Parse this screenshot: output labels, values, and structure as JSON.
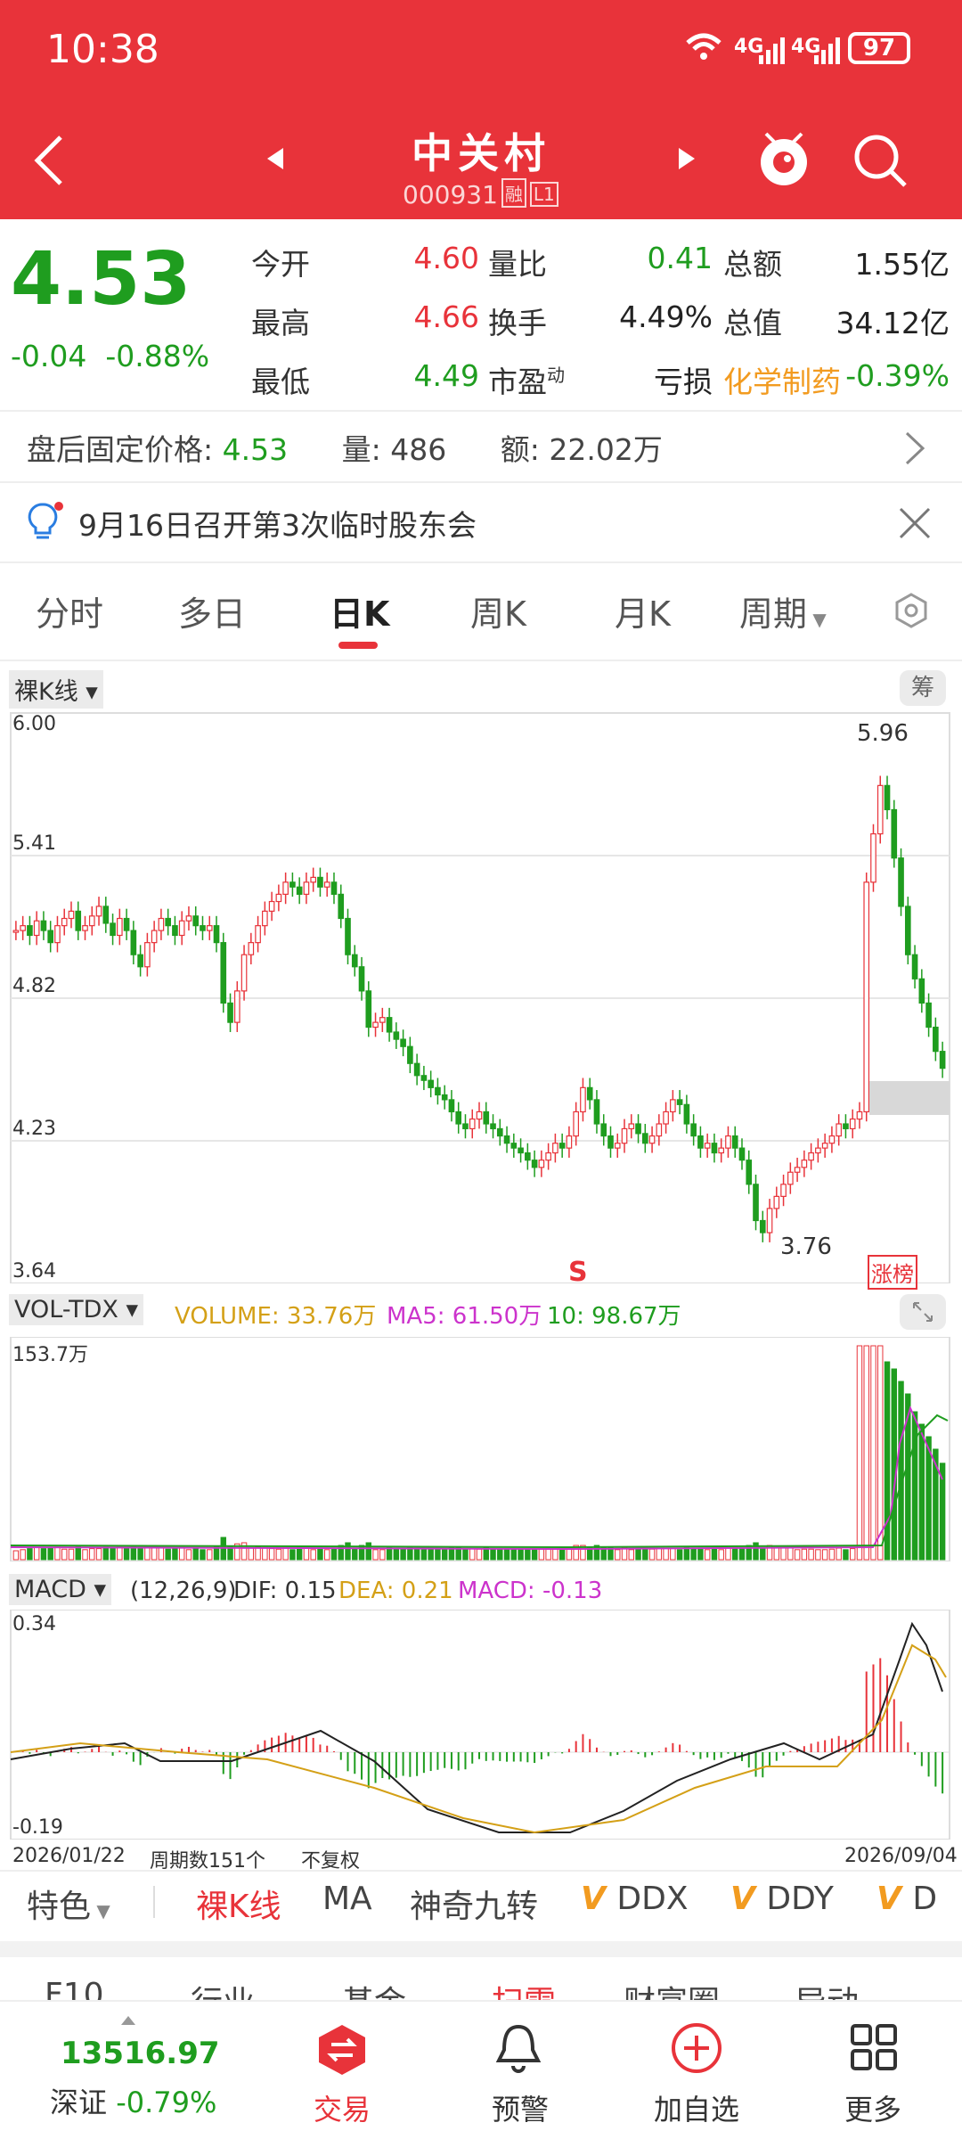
{
  "status": {
    "time": "10:38",
    "battery": "97",
    "net1": "4G",
    "net2": "4G"
  },
  "header": {
    "title": "中关村",
    "code": "000931",
    "tag1": "融",
    "tag2": "L1"
  },
  "quote": {
    "price": "4.53",
    "change": "-0.04",
    "change_pct": "-0.88%",
    "rows": [
      {
        "l1": "今开",
        "v1": "4.60",
        "l2": "量比",
        "v2": "0.41",
        "l3": "总额",
        "v3": "1.55亿"
      },
      {
        "l1": "最高",
        "v1": "4.66",
        "l2": "换手",
        "v2": "4.49%",
        "l3": "总值",
        "v3": "34.12亿"
      },
      {
        "l1": "最低",
        "v1": "4.49",
        "l2": "市盈",
        "l2sup": "动",
        "v2": "亏损",
        "l3": "化学制药",
        "v3": "-0.39%"
      }
    ]
  },
  "afterhours": {
    "price_label": "盘后固定价格:",
    "price": "4.53",
    "vol_label": "量:",
    "vol": "486",
    "amt_label": "额:",
    "amt": "22.02万"
  },
  "notice": {
    "text": "9月16日召开第3次临时股东会"
  },
  "tabs": [
    "分时",
    "多日",
    "日K",
    "周K",
    "月K",
    "周期"
  ],
  "kline": {
    "selector": "裸K线",
    "chip_button": "筹",
    "y_ticks": [
      "6.00",
      "5.41",
      "4.82",
      "4.23",
      "3.64"
    ],
    "high_label": "5.96",
    "low_label": "3.76",
    "s_marker": "S",
    "badge": "涨榜"
  },
  "volume": {
    "selector": "VOL-TDX",
    "label_volume": "VOLUME: 33.76万",
    "label_ma5": "MA5: 61.50万",
    "label_ma10": "10: 98.67万",
    "y_top": "153.7万",
    "colors": {
      "vol": "#d4a017",
      "ma5": "#cc33cc",
      "ma10": "#1f9d1f"
    }
  },
  "macd": {
    "selector": "MACD",
    "params": "(12,26,9)",
    "dif": "DIF: 0.15",
    "dea": "DEA: 0.21",
    "macd": "MACD: -0.13",
    "y_top": "0.34",
    "y_bottom": "-0.19",
    "start_date": "2026/01/22",
    "period_count": "周期数151个",
    "adjust": "不复权",
    "end_date": "2026/09/04"
  },
  "indicator_bar": [
    "特色",
    "裸K线",
    "MA",
    "神奇九转",
    "DDX",
    "DDY",
    "D"
  ],
  "lower_tabs": [
    "F10",
    "行业",
    "基金",
    "扫雷",
    "财富圈",
    "异动"
  ],
  "bottom_nav": {
    "index_value": "13516.97",
    "index_name": "深证",
    "index_change": "-0.79%",
    "items": [
      "交易",
      "预警",
      "加自选",
      "更多"
    ]
  },
  "chart_data": {
    "type": "candlestick",
    "x_range": [
      "2026/01/22",
      "2026/09/04"
    ],
    "ylim": [
      3.64,
      6.0
    ],
    "n_periods": 151,
    "high": 5.96,
    "low": 3.76,
    "last_close": 4.53,
    "closes": [
      5.1,
      5.12,
      5.08,
      5.14,
      5.1,
      5.05,
      5.12,
      5.15,
      5.18,
      5.1,
      5.12,
      5.16,
      5.2,
      5.13,
      5.08,
      5.15,
      5.1,
      5.0,
      4.95,
      5.05,
      5.1,
      5.15,
      5.12,
      5.08,
      5.14,
      5.16,
      5.12,
      5.1,
      5.12,
      5.05,
      4.8,
      4.72,
      4.85,
      5.0,
      5.05,
      5.12,
      5.18,
      5.22,
      5.25,
      5.3,
      5.28,
      5.25,
      5.3,
      5.32,
      5.28,
      5.3,
      5.25,
      5.15,
      5.0,
      4.95,
      4.85,
      4.7,
      4.72,
      4.74,
      4.68,
      4.65,
      4.62,
      4.55,
      4.5,
      4.48,
      4.45,
      4.42,
      4.4,
      4.35,
      4.3,
      4.28,
      4.32,
      4.35,
      4.3,
      4.28,
      4.25,
      4.22,
      4.2,
      4.18,
      4.15,
      4.12,
      4.15,
      4.18,
      4.22,
      4.2,
      4.25,
      4.35,
      4.45,
      4.4,
      4.3,
      4.25,
      4.2,
      4.22,
      4.28,
      4.3,
      4.26,
      4.22,
      4.25,
      4.3,
      4.35,
      4.4,
      4.38,
      4.3,
      4.25,
      4.2,
      4.22,
      4.18,
      4.2,
      4.25,
      4.2,
      4.15,
      4.05,
      3.9,
      3.85,
      3.95,
      4.0,
      4.05,
      4.1,
      4.12,
      4.15,
      4.18,
      4.2,
      4.22,
      4.25,
      4.3,
      4.28,
      4.32,
      4.35,
      5.3,
      5.5,
      5.7,
      5.6,
      5.4,
      5.2,
      5.0,
      4.9,
      4.8,
      4.7,
      4.6,
      4.53
    ],
    "volume_y_top": "153.7万",
    "macd_range": [
      -0.19,
      0.34
    ]
  }
}
